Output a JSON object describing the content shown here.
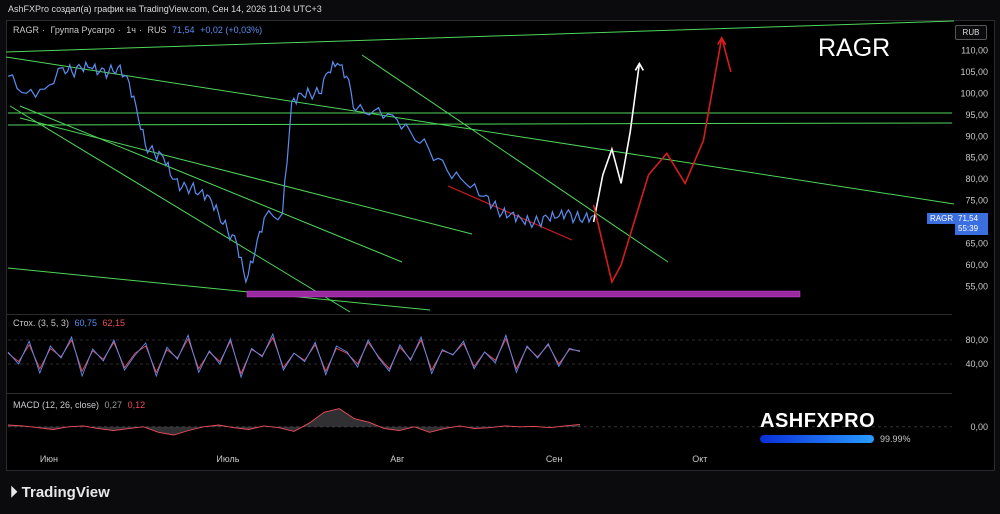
{
  "header": {
    "creator_line": "AshFXPro создал(а) график на TradingView.com, Сен 14, 2026 11:04 UTC+3"
  },
  "legend": {
    "ticker": "RAGR",
    "name": "Группа Русагро",
    "timeframe": "1ч",
    "exchange": "RUS",
    "last": "71,54",
    "change": "+0,02 (+0,03%)"
  },
  "overlay_symbol": "RAGR",
  "currency": "RUB",
  "price_tag": {
    "symbol": "RAGR",
    "price": "71,54",
    "countdown": "55:39"
  },
  "stoch": {
    "label": "Стох. (3, 5, 3)",
    "k": "60,75",
    "d": "62,15"
  },
  "macd": {
    "label": "MACD (12, 26, close)",
    "macd": "0,27",
    "signal": "0,12"
  },
  "watermark": {
    "text": "ASHFXPRO",
    "percent": "99.99%"
  },
  "footer": {
    "brand": "TradingView"
  },
  "colors": {
    "price": "#5b8def",
    "trend": "#4fd65a",
    "zone": "#9b2aa0",
    "projection_red": "#d41e1e",
    "projection_white": "#ffffff",
    "macd_line": "#ef4b5a"
  },
  "chart_data": [
    {
      "type": "line",
      "title": "RAGR · Группа Русагро · 1ч · RUS",
      "xlabel": "",
      "ylabel": "",
      "x_ticks": [
        "Июн",
        "Июль",
        "Авг",
        "Сен",
        "Окт"
      ],
      "y_ticks": [
        "110,00",
        "105,00",
        "100,00",
        "95,00",
        "90,00",
        "85,00",
        "80,00",
        "75,00",
        "70,00",
        "65,00",
        "60,00",
        "55,00"
      ],
      "ylim": [
        52.5,
        112
      ],
      "series": [
        {
          "name": "RAGR",
          "x": [
            0,
            2,
            4,
            6,
            7,
            8,
            9,
            10,
            11,
            12,
            13,
            14,
            15,
            16,
            17,
            18,
            19,
            20,
            21,
            22,
            23,
            24,
            25,
            26,
            27,
            28,
            30,
            31,
            32,
            33,
            34,
            35,
            36,
            37,
            38,
            40,
            42,
            44,
            46,
            48,
            50,
            52,
            53,
            54,
            55,
            56,
            57,
            58,
            59,
            60,
            61,
            62,
            63,
            64
          ],
          "values": [
            104,
            100,
            101,
            106,
            105,
            106,
            106,
            105,
            105,
            106,
            104,
            97,
            88,
            86,
            85,
            80,
            78,
            78,
            77,
            76,
            72,
            68,
            65,
            56,
            63,
            71,
            72,
            98,
            100,
            100,
            100,
            105,
            107,
            104,
            96,
            96,
            95,
            91,
            87,
            82,
            79,
            76,
            74,
            72,
            72,
            71,
            70,
            70,
            71,
            71,
            72,
            71,
            71,
            71.54
          ]
        },
        {
          "name": "Projection A",
          "x": [
            64,
            65,
            66,
            67,
            68,
            69
          ],
          "values": [
            70,
            81,
            87,
            79,
            91,
            107
          ]
        },
        {
          "name": "Projection B",
          "x": [
            64,
            66,
            67,
            69,
            70,
            72,
            74,
            76,
            78,
            79
          ],
          "values": [
            74,
            56,
            60,
            74,
            81,
            86,
            79,
            89,
            113,
            105
          ]
        }
      ]
    },
    {
      "type": "line",
      "title": "Стох. (3, 5, 3)",
      "y_ticks": [
        "80,00",
        "40,00"
      ],
      "ylim": [
        0,
        110
      ],
      "series": [
        {
          "name": "%K",
          "values": [
            60,
            40,
            78,
            25,
            70,
            50,
            85,
            20,
            65,
            45,
            80,
            30,
            55,
            75,
            20,
            68,
            48,
            88,
            26,
            62,
            40,
            82,
            18,
            66,
            52,
            90,
            30,
            58,
            44,
            76,
            22,
            70,
            60,
            35,
            80,
            50,
            28,
            72,
            46,
            85,
            24,
            64,
            55,
            78,
            32,
            60,
            42,
            88,
            26,
            70,
            50,
            74,
            36,
            66,
            60.75
          ]
        },
        {
          "name": "%D",
          "values": [
            58,
            44,
            72,
            32,
            66,
            52,
            80,
            28,
            62,
            48,
            76,
            34,
            58,
            70,
            26,
            64,
            50,
            82,
            32,
            60,
            44,
            78,
            24,
            64,
            54,
            84,
            34,
            58,
            46,
            72,
            28,
            66,
            58,
            40,
            76,
            52,
            32,
            68,
            48,
            80,
            30,
            62,
            56,
            74,
            36,
            60,
            46,
            82,
            32,
            68,
            52,
            72,
            40,
            64,
            62.15
          ]
        }
      ]
    },
    {
      "type": "area",
      "title": "MACD (12, 26, close)",
      "y_ticks": [
        "0,00"
      ],
      "ylim": [
        -2,
        2.4
      ],
      "series": [
        {
          "name": "MACD",
          "values": [
            0.2,
            0.1,
            -0.1,
            -0.3,
            0,
            0.1,
            -0.2,
            -0.4,
            -0.2,
            0,
            -0.6,
            -0.9,
            -0.4,
            0,
            0.2,
            -0.1,
            -0.3,
            0.1,
            -0.1,
            -0.5,
            0.4,
            1.6,
            2.0,
            0.9,
            0.5,
            -0.2,
            -0.4,
            0,
            -0.6,
            -0.2,
            0.1,
            -0.2,
            -0.1,
            0.1,
            0,
            0.05,
            -0.1,
            0.1,
            0.27
          ]
        }
      ]
    }
  ]
}
